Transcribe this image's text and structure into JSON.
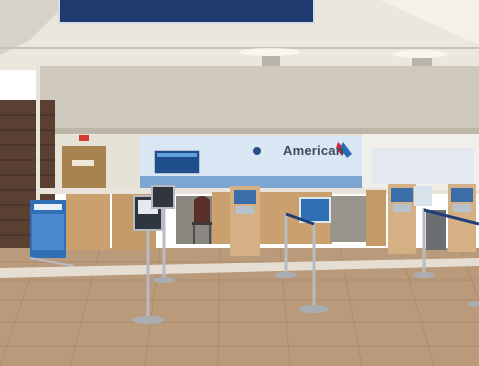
{
  "scene": {
    "description_kind": "photo",
    "brand_sign": "American",
    "colors": {
      "overlay_banner": "#1f3a6e",
      "ceiling": "#ece8e0",
      "upper_wall": "#cfc8bc",
      "counter_wood": "#c9a06e",
      "floor_tile": "#b99a7a",
      "floor_stripe": "#e6ded2",
      "brand_backdrop": "#d9e7f5",
      "blue_sign": "#2f6fb5",
      "brick": "#5a4032",
      "stanchion": "#b8bcc2"
    },
    "icons": [
      "flight-info-monitor-icon",
      "exit-sign-icon",
      "american-flag-logo-icon",
      "check-in-kiosk-icon",
      "stanchion-post-icon",
      "brochure-stand-icon"
    ]
  }
}
